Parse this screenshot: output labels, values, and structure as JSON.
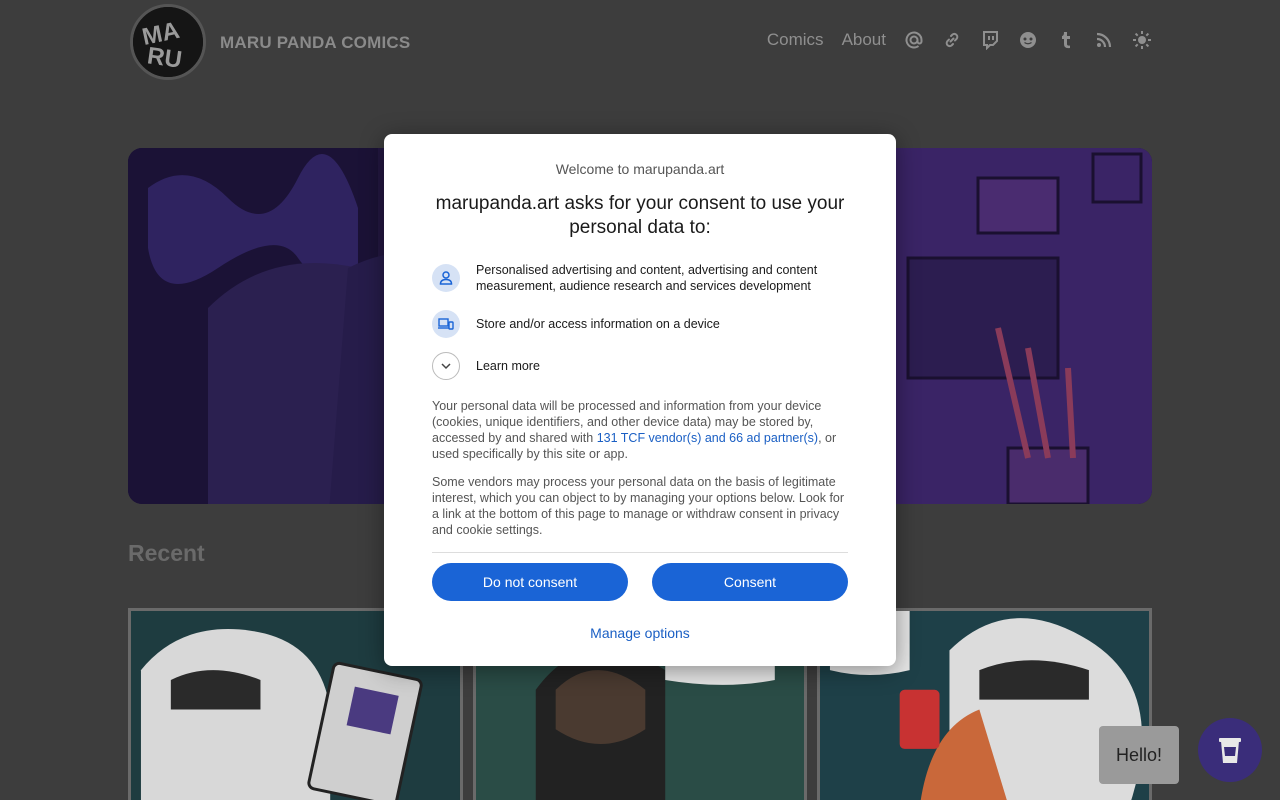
{
  "site": {
    "title": "MARU PANDA COMICS",
    "nav": {
      "comics": "Comics",
      "about": "About",
      "icons": [
        "at-icon",
        "link-icon",
        "twitch-icon",
        "reddit-icon",
        "tumblr-icon",
        "rss-icon",
        "theme-toggle-icon"
      ]
    },
    "recent_heading": "Recent",
    "hello_label": "Hello!"
  },
  "consent": {
    "welcome": "Welcome to marupanda.art",
    "heading": "marupanda.art asks for your consent to use your personal data to:",
    "purposes": [
      {
        "icon": "person-icon",
        "text": "Personalised advertising and content, advertising and content measurement, audience research and services development"
      },
      {
        "icon": "devices-icon",
        "text": "Store and/or access information on a device"
      }
    ],
    "learn_more": "Learn more",
    "paragraph1_before": "Your personal data will be processed and information from your device (cookies, unique identifiers, and other device data) may be stored by, accessed by and shared with ",
    "paragraph1_link": "131 TCF vendor(s) and 66 ad partner(s)",
    "paragraph1_after": ", or used specifically by this site or app.",
    "paragraph2": "Some vendors may process your personal data on the basis of legitimate interest, which you can object to by managing your options below. Look for a link at the bottom of this page to manage or withdraw consent in privacy and cookie settings.",
    "do_not_consent": "Do not consent",
    "consent": "Consent",
    "manage_options": "Manage options"
  },
  "colors": {
    "primary_button": "#1a64d6",
    "link": "#1a5fc4",
    "coffee_button": "#3a2d7a"
  }
}
